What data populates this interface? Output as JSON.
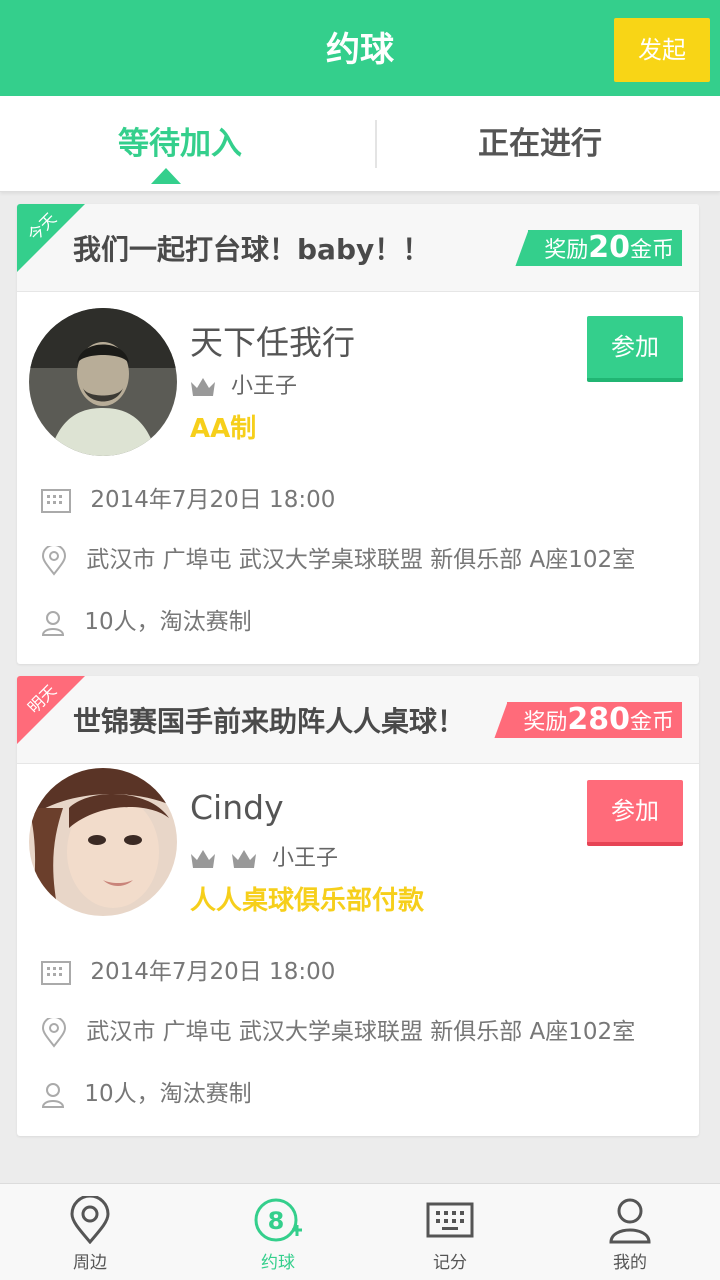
{
  "header": {
    "title": "约球",
    "launch_button": "发起"
  },
  "tabs": [
    {
      "label": "等待加入",
      "active": true
    },
    {
      "label": "正在进行",
      "active": false
    }
  ],
  "colors": {
    "primary": "#34cf8c",
    "accent_yellow": "#f8d516",
    "accent_red": "#ff6b7a"
  },
  "events": [
    {
      "ribbon": "今天",
      "title": "我们一起打台球！baby！！",
      "reward": {
        "prefix": "奖励",
        "amount": "20",
        "suffix": "金币"
      },
      "organizer": "天下任我行",
      "crowns": 1,
      "level": "小王子",
      "payment": "AA制",
      "join_label": "参加",
      "datetime": "2014年7月20日 18:00",
      "location": "武汉市 广埠屯 武汉大学桌球联盟  新俱乐部  A座102室",
      "participants": "10人，淘汰赛制"
    },
    {
      "ribbon": "明天",
      "title": "世锦赛国手前来助阵人人桌球！",
      "reward": {
        "prefix": "奖励",
        "amount": "280",
        "suffix": "金币"
      },
      "organizer": "Cindy",
      "crowns": 2,
      "level": "小王子",
      "payment": "人人桌球俱乐部付款",
      "join_label": "参加",
      "datetime": "2014年7月20日 18:00",
      "location": "武汉市 广埠屯 武汉大学桌球联盟  新俱乐部  A座102室",
      "participants": "10人，淘汰赛制"
    }
  ],
  "bottom_nav": [
    {
      "label": "周边",
      "icon": "location-pin-icon",
      "active": false
    },
    {
      "label": "约球",
      "icon": "ball-eight-icon",
      "active": true
    },
    {
      "label": "记分",
      "icon": "scoreboard-icon",
      "active": false
    },
    {
      "label": "我的",
      "icon": "user-icon",
      "active": false
    }
  ]
}
